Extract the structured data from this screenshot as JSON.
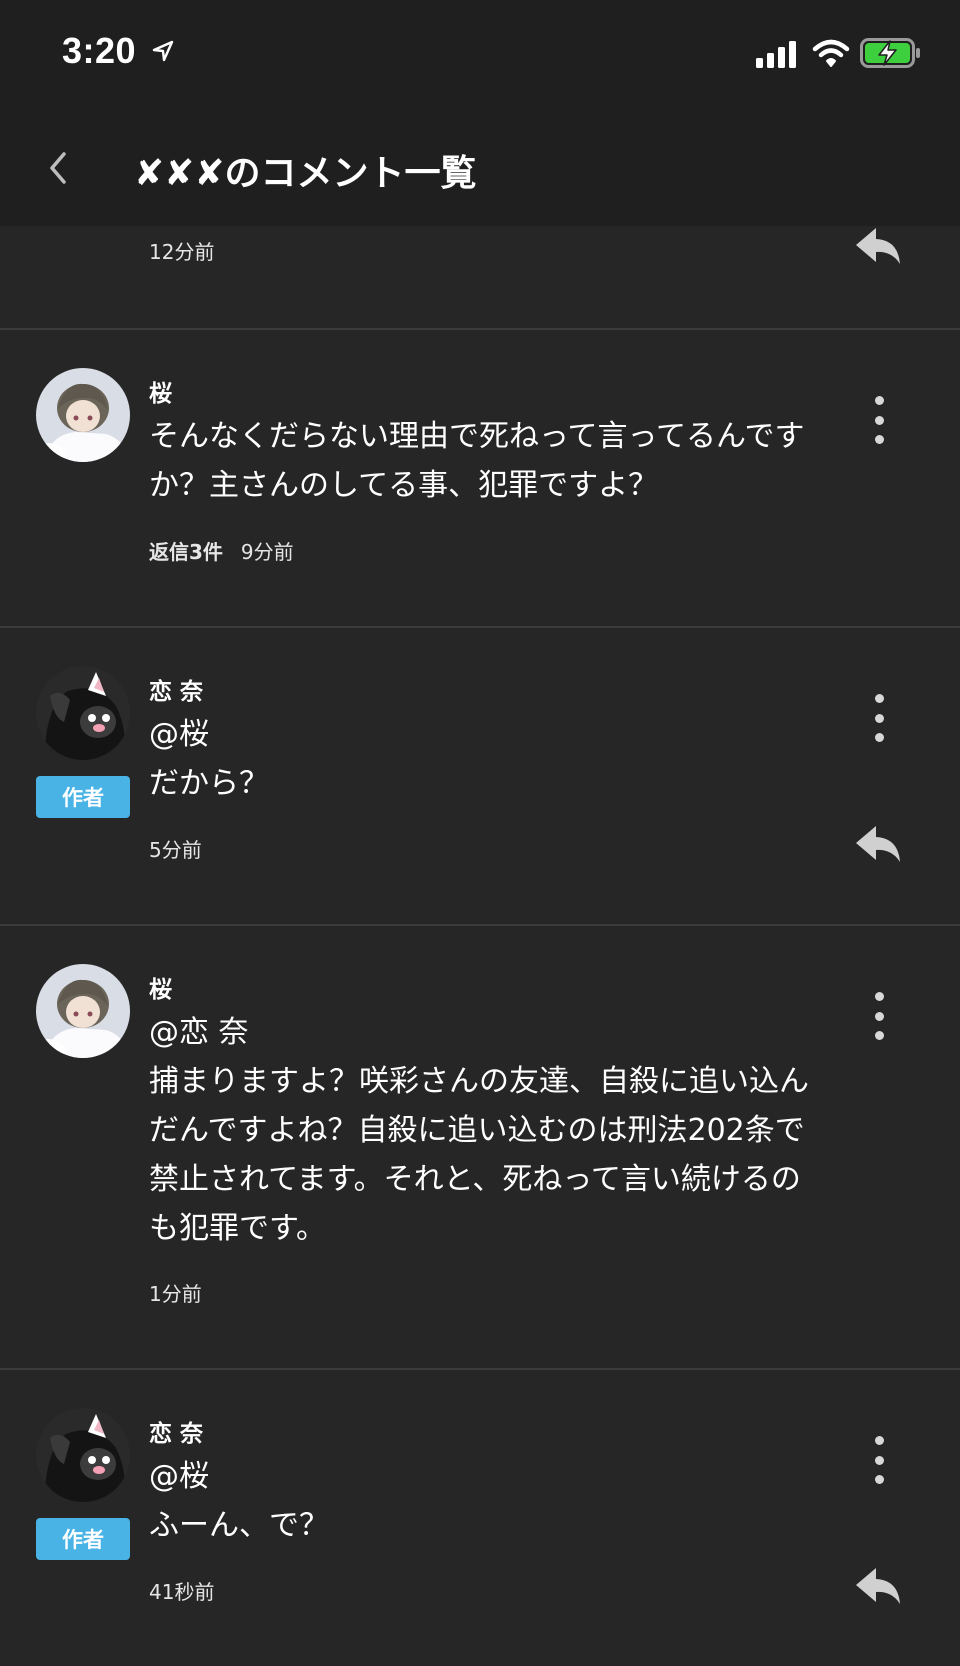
{
  "status_bar": {
    "time": "3:20"
  },
  "header": {
    "title": "✘✘✘のコメント一覧"
  },
  "comments": [
    {
      "timestamp": "12分前"
    },
    {
      "name": "桜",
      "text": "そんなくだらない理由で死ねって言ってるんですか？主さんのしてる事、犯罪ですよ？",
      "replies": "返信3件",
      "timestamp": "9分前"
    },
    {
      "name": "恋 奈",
      "badge": "作者",
      "mention": "@桜",
      "text": "だから？",
      "timestamp": "5分前"
    },
    {
      "name": "桜",
      "mention": "@恋 奈",
      "text": "捕まりますよ？咲彩さんの友達、自殺に追い込んだんですよね？自殺に追い込むのは刑法202条で禁止されてます。それと、死ねって言い続けるのも犯罪です。",
      "timestamp": "1分前"
    },
    {
      "name": "恋 奈",
      "badge": "作者",
      "mention": "@桜",
      "text": "ふーん、で？",
      "timestamp": "41秒前"
    }
  ],
  "icons": [
    "location-arrow-icon",
    "signal-icon",
    "wifi-icon",
    "battery-charging-icon",
    "back-chevron-icon",
    "more-vertical-icon",
    "reply-icon"
  ],
  "colors": {
    "background": "#262626",
    "header": "#1f1f1f",
    "badge": "#4ab3e6",
    "divider": "#3b3b3b",
    "battery": "#3ecf3e"
  }
}
